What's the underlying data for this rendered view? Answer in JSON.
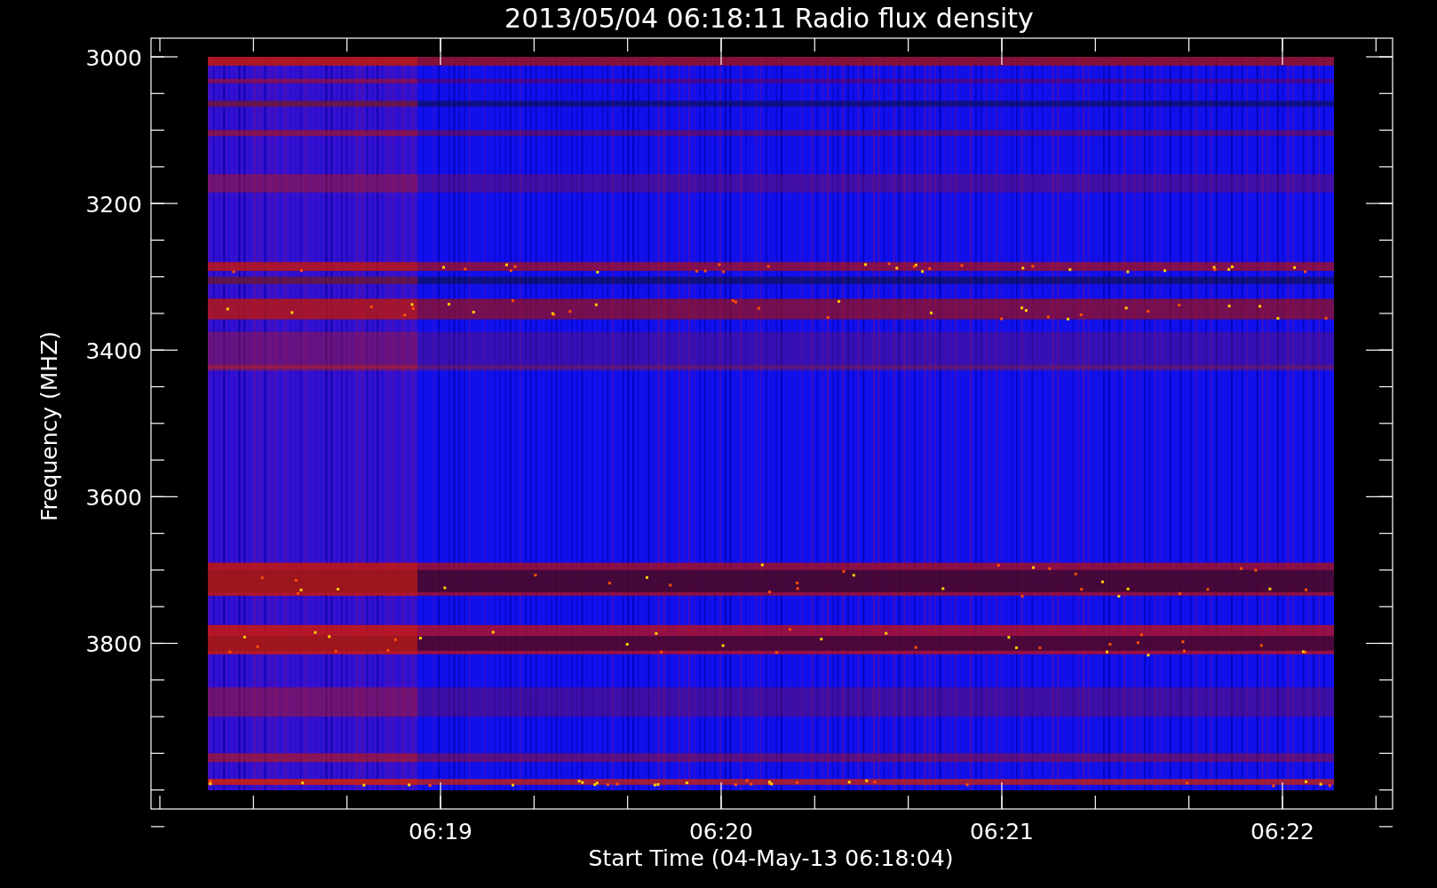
{
  "title": "2013/05/04 06:18:11 Radio flux density",
  "y_axis": {
    "label": "Frequency (MHZ)",
    "ticks": [
      "3000",
      "3200",
      "3400",
      "3600",
      "3800"
    ]
  },
  "x_axis": {
    "label": "Start Time (04-May-13 06:18:04)",
    "ticks": [
      "06:19",
      "06:20",
      "06:21",
      "06:22"
    ]
  }
}
